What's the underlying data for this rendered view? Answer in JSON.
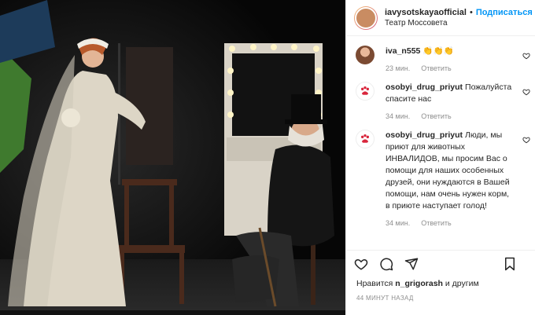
{
  "post": {
    "username": "iavysotskayaofficial",
    "separator": "•",
    "follow_label": "Подписаться",
    "location": "Театр Моссовета"
  },
  "comments": [
    {
      "user": "iva_n555",
      "text": "👏👏👏",
      "time": "23 мин.",
      "reply": "Ответить",
      "avatar": "person-photo"
    },
    {
      "user": "osobyi_drug_priyut",
      "text": "Пожалуйста спасите нас",
      "time": "34 мин.",
      "reply": "Ответить",
      "avatar": "paw-logo"
    },
    {
      "user": "osobyi_drug_priyut",
      "text": "Люди, мы приют для животных ИНВАЛИДОВ, мы просим Вас о помощи для наших особенных друзей, они нуждаются в Вашей помощи, нам очень нужен корм, в приюте наступает голод!",
      "time": "34 мин.",
      "reply": "Ответить",
      "avatar": "paw-logo"
    }
  ],
  "likes": {
    "prefix": "Нравится",
    "user": "n_grigorash",
    "suffix": "и другим"
  },
  "posted_ago": "44 МИНУТ НАЗАД",
  "colors": {
    "accent": "#0095f6",
    "muted": "#8e8e8e",
    "paw": "#d9263c"
  }
}
